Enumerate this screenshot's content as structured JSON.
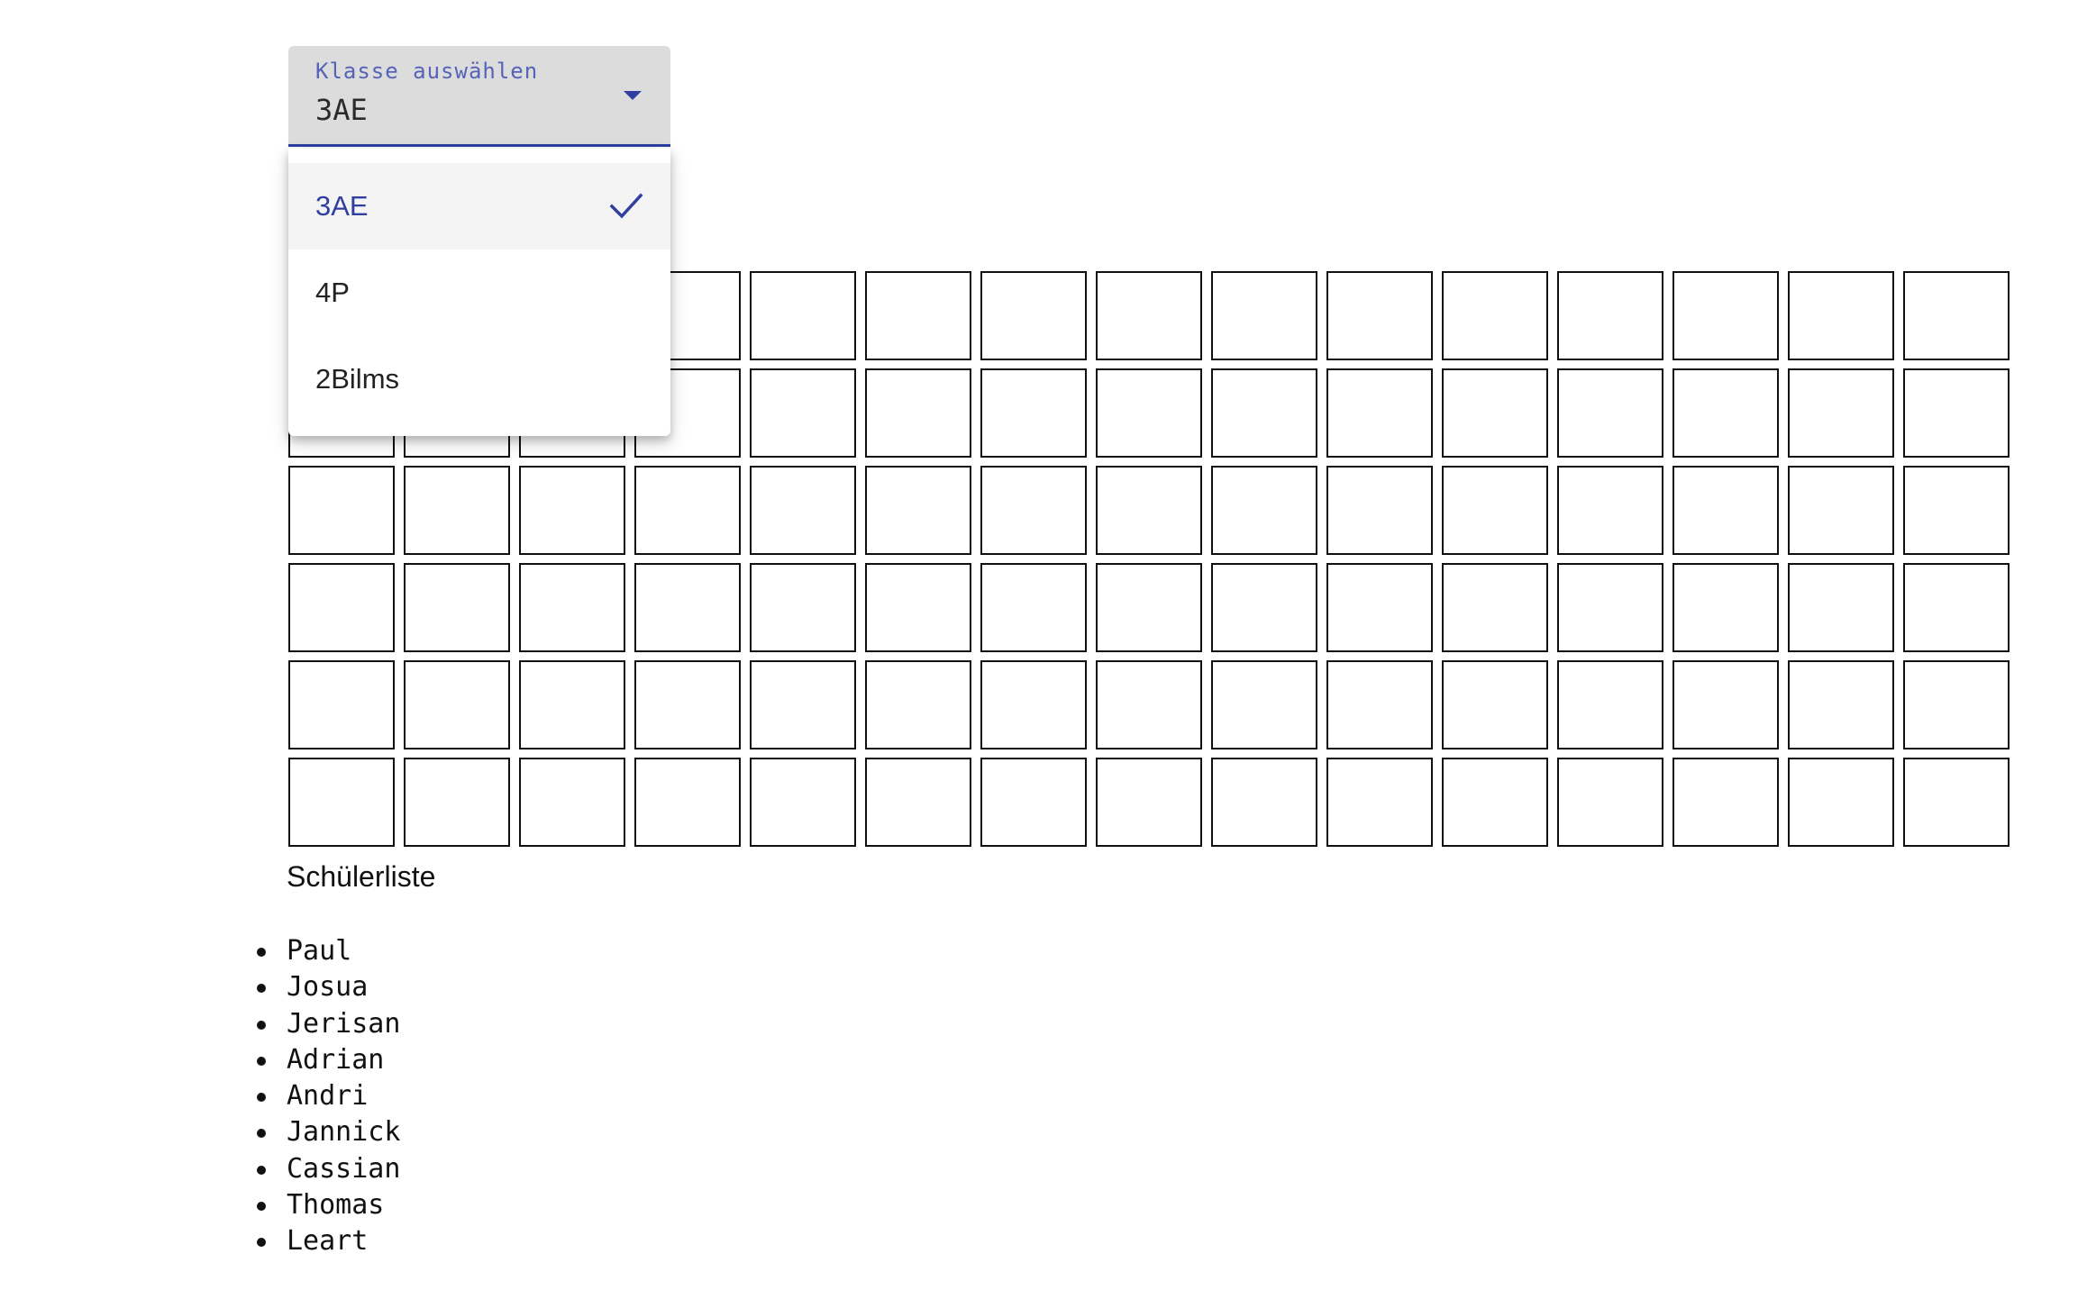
{
  "class_select": {
    "label": "Klasse auswählen",
    "value": "3AE",
    "options": [
      {
        "label": "3AE",
        "selected": true
      },
      {
        "label": "4P",
        "selected": false
      },
      {
        "label": "2Bilms",
        "selected": false
      }
    ]
  },
  "student_list": {
    "title": "Schülerliste",
    "students": [
      "Paul",
      "Josua",
      "Jerisan",
      "Adrian",
      "Andri",
      "Jannick",
      "Cassian",
      "Thomas",
      "Leart"
    ]
  },
  "colors": {
    "accent": "#2f3fa0",
    "field_bg": "#dcdcdc",
    "selected_option_bg": "#f4f4f4"
  },
  "icons": {
    "select_arrow": "chevron-down-icon",
    "selected_option": "check-icon"
  }
}
